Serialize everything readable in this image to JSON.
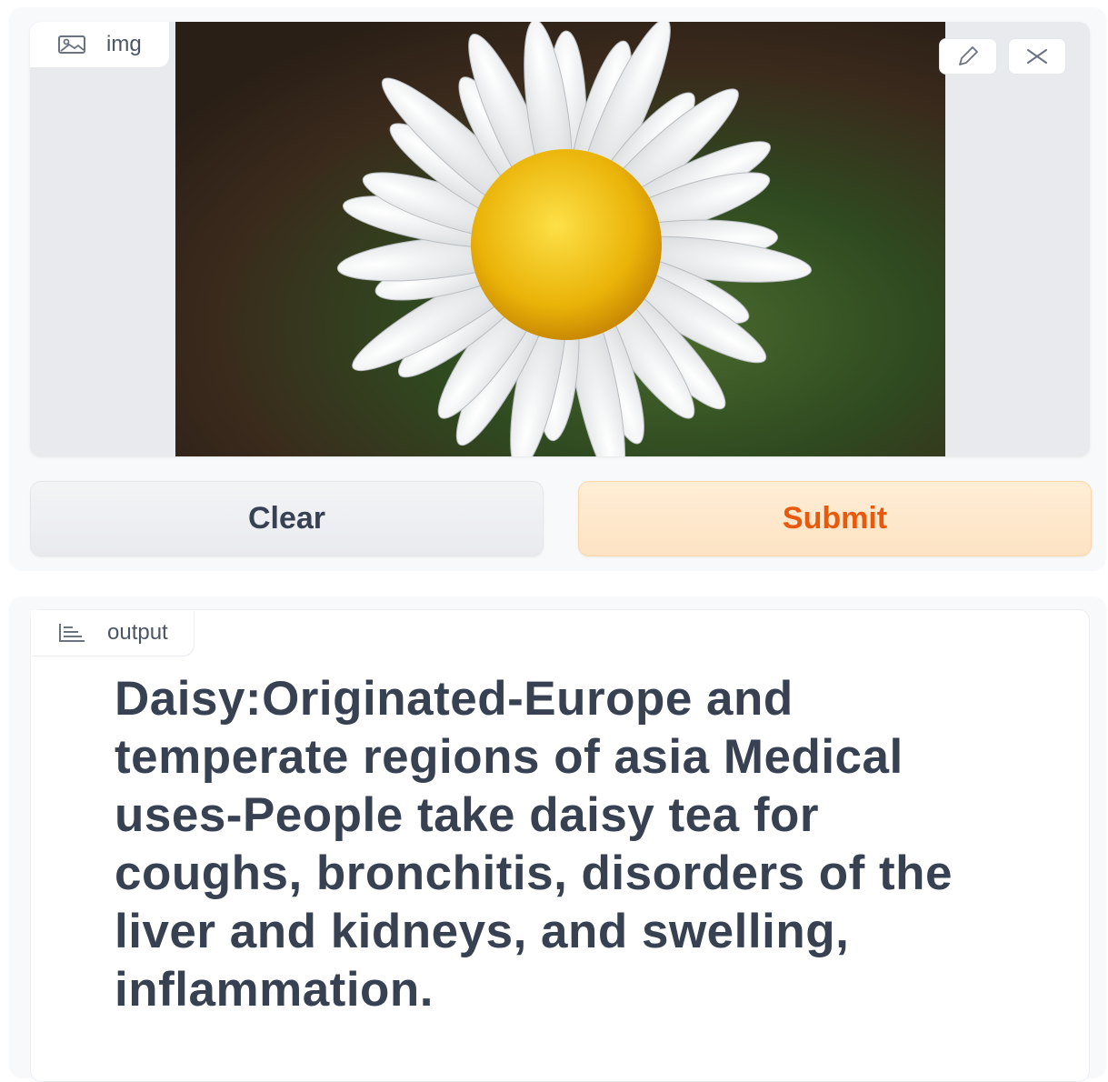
{
  "input": {
    "label": "img",
    "label_icon": "image-icon",
    "edit_icon": "pencil-icon",
    "close_icon": "close-icon",
    "image_description_icon": "daisy-photo"
  },
  "buttons": {
    "clear_label": "Clear",
    "submit_label": "Submit"
  },
  "output": {
    "label": "output",
    "label_icon": "chart-icon",
    "text": "Daisy:Originated-Europe and temperate regions of asia Medical uses-People take daisy tea for coughs, bronchitis, disorders of the liver and kidneys, and swelling, inflammation."
  },
  "colors": {
    "submit_text": "#ea580c",
    "submit_bg": "#ffedd5",
    "clear_text": "#374151"
  }
}
